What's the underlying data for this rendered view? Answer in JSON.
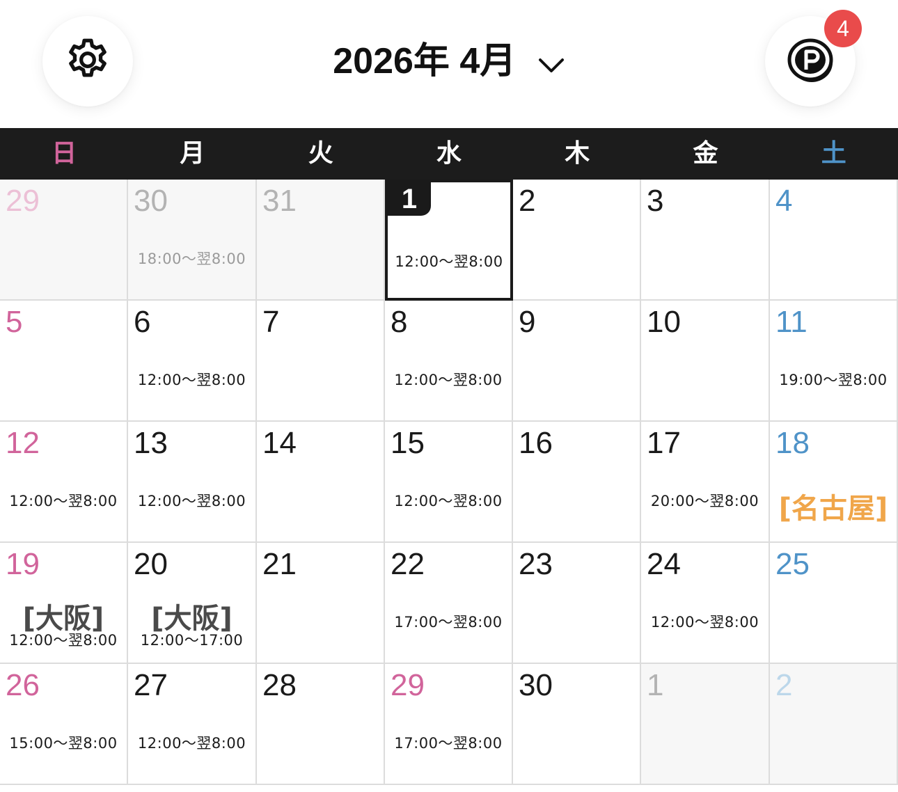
{
  "header": {
    "title": "2026年 4月",
    "badge_count": "4",
    "settings_icon": "gear-icon",
    "points_icon": "point-coin-icon",
    "dropdown_icon": "chevron-down-icon"
  },
  "colors": {
    "sunday": "#d1649b",
    "saturday": "#4f93c8",
    "badge": "#e94b4b",
    "city_highlight": "#f0a64a",
    "header_bar": "#1c1c1c"
  },
  "weekdays": [
    "日",
    "月",
    "火",
    "水",
    "木",
    "金",
    "土"
  ],
  "weeks": [
    [
      {
        "day": "29",
        "outside": true,
        "time": ""
      },
      {
        "day": "30",
        "outside": true,
        "time": "18:00〜翌8:00"
      },
      {
        "day": "31",
        "outside": true,
        "time": ""
      },
      {
        "day": "1",
        "today": true,
        "time": "12:00〜翌8:00"
      },
      {
        "day": "2",
        "time": ""
      },
      {
        "day": "3",
        "time": ""
      },
      {
        "day": "4",
        "time": ""
      }
    ],
    [
      {
        "day": "5",
        "time": ""
      },
      {
        "day": "6",
        "time": "12:00〜翌8:00"
      },
      {
        "day": "7",
        "time": ""
      },
      {
        "day": "8",
        "time": "12:00〜翌8:00"
      },
      {
        "day": "9",
        "time": ""
      },
      {
        "day": "10",
        "time": ""
      },
      {
        "day": "11",
        "time": "19:00〜翌8:00"
      }
    ],
    [
      {
        "day": "12",
        "time": "12:00〜翌8:00"
      },
      {
        "day": "13",
        "time": "12:00〜翌8:00"
      },
      {
        "day": "14",
        "time": ""
      },
      {
        "day": "15",
        "time": "12:00〜翌8:00"
      },
      {
        "day": "16",
        "time": ""
      },
      {
        "day": "17",
        "time": "20:00〜翌8:00"
      },
      {
        "day": "18",
        "time": "",
        "city": "[名古屋]",
        "city_color": "orange"
      }
    ],
    [
      {
        "day": "19",
        "time": "12:00〜翌8:00",
        "city": "[大阪]"
      },
      {
        "day": "20",
        "time": "12:00〜17:00",
        "city": "[大阪]"
      },
      {
        "day": "21",
        "time": ""
      },
      {
        "day": "22",
        "time": "17:00〜翌8:00"
      },
      {
        "day": "23",
        "time": ""
      },
      {
        "day": "24",
        "time": "12:00〜翌8:00"
      },
      {
        "day": "25",
        "time": ""
      }
    ],
    [
      {
        "day": "26",
        "time": "15:00〜翌8:00"
      },
      {
        "day": "27",
        "time": "12:00〜翌8:00"
      },
      {
        "day": "28",
        "time": ""
      },
      {
        "day": "29",
        "time": "17:00〜翌8:00",
        "holiday": true
      },
      {
        "day": "30",
        "time": ""
      },
      {
        "day": "1",
        "outside": true,
        "time": ""
      },
      {
        "day": "2",
        "outside": true,
        "time": ""
      }
    ]
  ]
}
